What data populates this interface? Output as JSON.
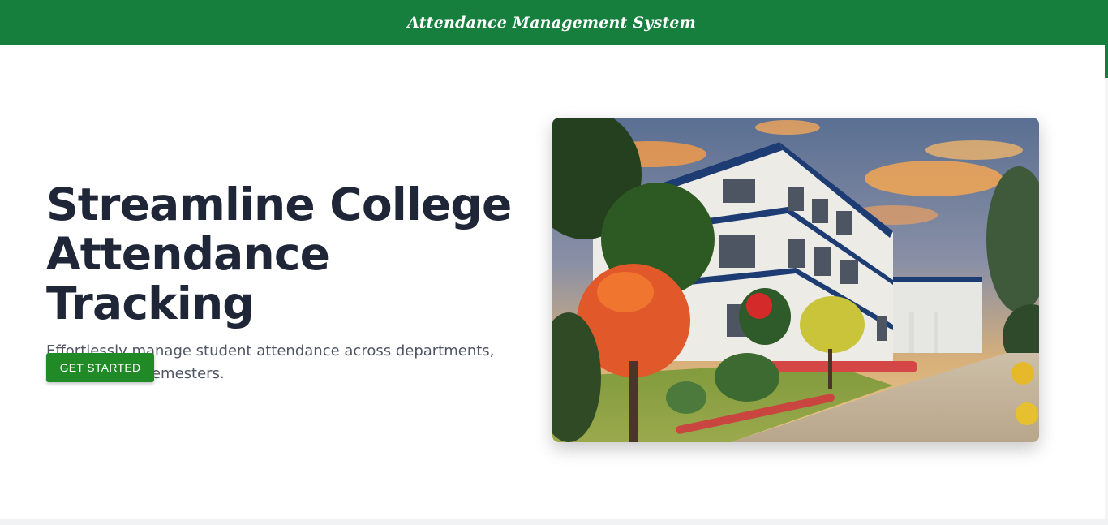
{
  "header": {
    "title": "Attendance Management System"
  },
  "hero": {
    "title_line1": "Streamline College",
    "title_line2": "Attendance Tracking",
    "subtitle": "Effortlessly manage student attendance across departments, courses, and semesters.",
    "cta_label": "GET STARTED",
    "image_subject": "college-campus-building-photo"
  },
  "colors": {
    "header_bg": "#177f3e",
    "cta_bg": "#1f8a26",
    "title_text": "#1e2638",
    "subtitle_text": "#4f5563"
  },
  "scrollbar": {
    "position_fraction": 0
  }
}
